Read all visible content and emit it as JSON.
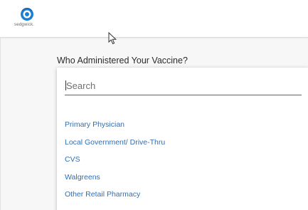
{
  "header": {
    "logo_text": "sedgwick."
  },
  "form": {
    "question_label": "Who Administered Your Vaccine?",
    "search": {
      "placeholder": "Search",
      "value": ""
    },
    "options": [
      "Primary Physician",
      "Local Government/ Drive-Thru",
      "CVS",
      "Walgreens",
      "Other Retail Pharmacy"
    ]
  },
  "colors": {
    "accent": "#2f6fb5",
    "logo_blue": "#1d7fd1",
    "text": "#2b2b2b"
  },
  "icons": {
    "logo": "sedgwick-logo",
    "pointer": "mouse-pointer-icon"
  }
}
